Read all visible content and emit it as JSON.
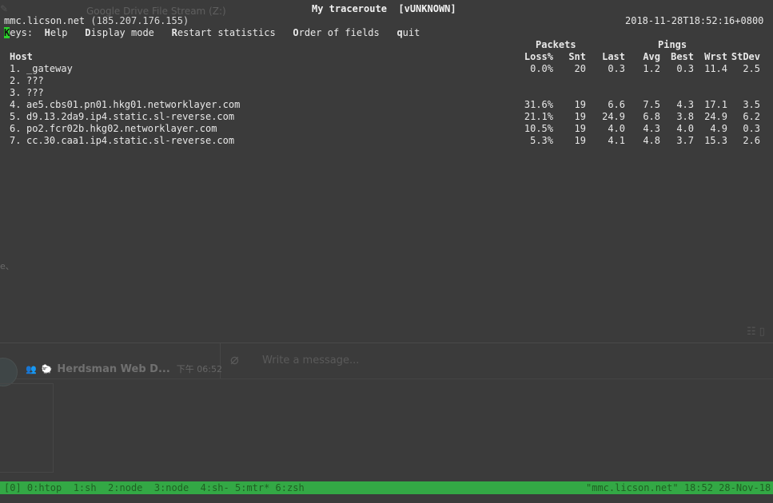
{
  "background_app": {
    "drive_title": "Google Drive File Stream (Z:)",
    "fragment": "e、",
    "chat_name": "Herdsman Web D...",
    "chat_time": "下午 06:52",
    "message_placeholder": "Write a message..."
  },
  "terminal": {
    "title": "My traceroute  [vUNKNOWN]",
    "host": "mmc.licson.net",
    "host_ip": "(185.207.176.155)",
    "timestamp": "2018-11-28T18:52:16+0800",
    "keys_label": "eys:",
    "keys_first_letter": "K",
    "menu": [
      {
        "first": "H",
        "rest": "elp"
      },
      {
        "first": "D",
        "rest": "isplay mode"
      },
      {
        "first": "R",
        "rest": "estart statistics"
      },
      {
        "first": "O",
        "rest": "rder of fields"
      },
      {
        "first": "q",
        "rest": "uit"
      }
    ],
    "group_headers": {
      "packets": "Packets",
      "pings": "Pings"
    },
    "columns": {
      "host": "Host",
      "loss": "Loss%",
      "snt": "Snt",
      "last": "Last",
      "avg": "Avg",
      "best": "Best",
      "wrst": "Wrst",
      "stdev": "StDev"
    },
    "hops": [
      {
        "num": "1.",
        "host": "_gateway",
        "loss": "0.0%",
        "snt": "20",
        "last": "0.3",
        "avg": "1.2",
        "best": "0.3",
        "wrst": "11.4",
        "stdev": "2.5"
      },
      {
        "num": "2.",
        "host": "???",
        "loss": "",
        "snt": "",
        "last": "",
        "avg": "",
        "best": "",
        "wrst": "",
        "stdev": ""
      },
      {
        "num": "3.",
        "host": "???",
        "loss": "",
        "snt": "",
        "last": "",
        "avg": "",
        "best": "",
        "wrst": "",
        "stdev": ""
      },
      {
        "num": "4.",
        "host": "ae5.cbs01.pn01.hkg01.networklayer.com",
        "loss": "31.6%",
        "snt": "19",
        "last": "6.6",
        "avg": "7.5",
        "best": "4.3",
        "wrst": "17.1",
        "stdev": "3.5"
      },
      {
        "num": "5.",
        "host": "d9.13.2da9.ip4.static.sl-reverse.com",
        "loss": "21.1%",
        "snt": "19",
        "last": "24.9",
        "avg": "6.8",
        "best": "3.8",
        "wrst": "24.9",
        "stdev": "6.2"
      },
      {
        "num": "6.",
        "host": "po2.fcr02b.hkg02.networklayer.com",
        "loss": "10.5%",
        "snt": "19",
        "last": "4.0",
        "avg": "4.3",
        "best": "4.0",
        "wrst": "4.9",
        "stdev": "0.3"
      },
      {
        "num": "7.",
        "host": "cc.30.caa1.ip4.static.sl-reverse.com",
        "loss": "5.3%",
        "snt": "19",
        "last": "4.1",
        "avg": "4.8",
        "best": "3.7",
        "wrst": "15.3",
        "stdev": "2.6"
      }
    ]
  },
  "tmux": {
    "windows": "[0] 0:htop  1:sh  2:node  3:node  4:sh- 5:mtr* 6:zsh",
    "right": "\"mmc.licson.net\" 18:52 28-Nov-18",
    "bar_color": "#33a845"
  },
  "colors": {
    "key_highlight": "#2bd42b",
    "terminal_bg": "#3b3b3b"
  }
}
